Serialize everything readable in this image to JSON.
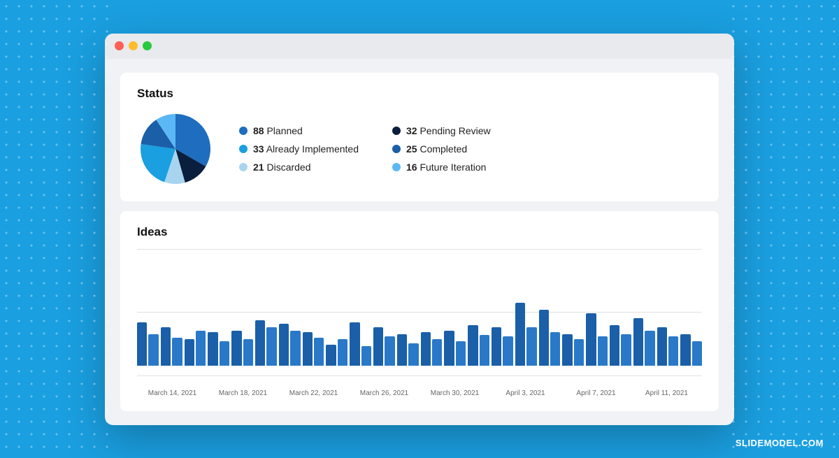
{
  "browser": {
    "titlebar": {
      "traffic_red": "red",
      "traffic_yellow": "yellow",
      "traffic_green": "green"
    }
  },
  "status_card": {
    "title": "Status",
    "legend": [
      {
        "count": "88",
        "label": "Planned",
        "color": "#1e6dbf",
        "col": 0
      },
      {
        "count": "33",
        "label": "Already Implemented",
        "color": "#1a9fe0",
        "col": 1
      },
      {
        "count": "32",
        "label": "Pending Review",
        "color": "#0a1f3d",
        "col": 0
      },
      {
        "count": "25",
        "label": "Completed",
        "color": "#1a5fa8",
        "col": 1
      },
      {
        "count": "21",
        "label": "Discarded",
        "color": "#a8d4f0",
        "col": 0
      },
      {
        "count": "16",
        "label": "Future Iteration",
        "color": "#5bb8f5",
        "col": 1
      }
    ],
    "pie": {
      "segments": [
        {
          "value": 88,
          "color": "#1e6dbf",
          "label": "Planned"
        },
        {
          "value": 32,
          "color": "#0a1f3d",
          "label": "Pending Review"
        },
        {
          "value": 21,
          "color": "#a8d4f0",
          "label": "Discarded"
        },
        {
          "value": 33,
          "color": "#1a9fe0",
          "label": "Already Implemented"
        },
        {
          "value": 25,
          "color": "#1a5fa8",
          "label": "Completed"
        },
        {
          "value": 16,
          "color": "#5bb8f5",
          "label": "Future Iteration"
        }
      ]
    }
  },
  "ideas_card": {
    "title": "Ideas",
    "bars": [
      {
        "h1": 62,
        "h2": 45
      },
      {
        "h1": 55,
        "h2": 40
      },
      {
        "h1": 38,
        "h2": 50
      },
      {
        "h1": 48,
        "h2": 35
      },
      {
        "h1": 50,
        "h2": 38
      },
      {
        "h1": 65,
        "h2": 55
      },
      {
        "h1": 60,
        "h2": 50
      },
      {
        "h1": 48,
        "h2": 40
      },
      {
        "h1": 30,
        "h2": 38
      },
      {
        "h1": 62,
        "h2": 28
      },
      {
        "h1": 55,
        "h2": 42
      },
      {
        "h1": 45,
        "h2": 32
      },
      {
        "h1": 48,
        "h2": 38
      },
      {
        "h1": 50,
        "h2": 35
      },
      {
        "h1": 58,
        "h2": 44
      },
      {
        "h1": 55,
        "h2": 42
      },
      {
        "h1": 90,
        "h2": 55
      },
      {
        "h1": 80,
        "h2": 48
      },
      {
        "h1": 45,
        "h2": 38
      },
      {
        "h1": 75,
        "h2": 42
      },
      {
        "h1": 58,
        "h2": 45
      },
      {
        "h1": 68,
        "h2": 50
      },
      {
        "h1": 55,
        "h2": 42
      },
      {
        "h1": 45,
        "h2": 35
      }
    ],
    "x_labels": [
      "March 14, 2021",
      "March 18, 2021",
      "March 22, 2021",
      "March 26, 2021",
      "March 30, 2021",
      "April 3, 2021",
      "April 7, 2021",
      "April 11, 2021"
    ]
  },
  "credit": "SLIDEMODEL.COM"
}
